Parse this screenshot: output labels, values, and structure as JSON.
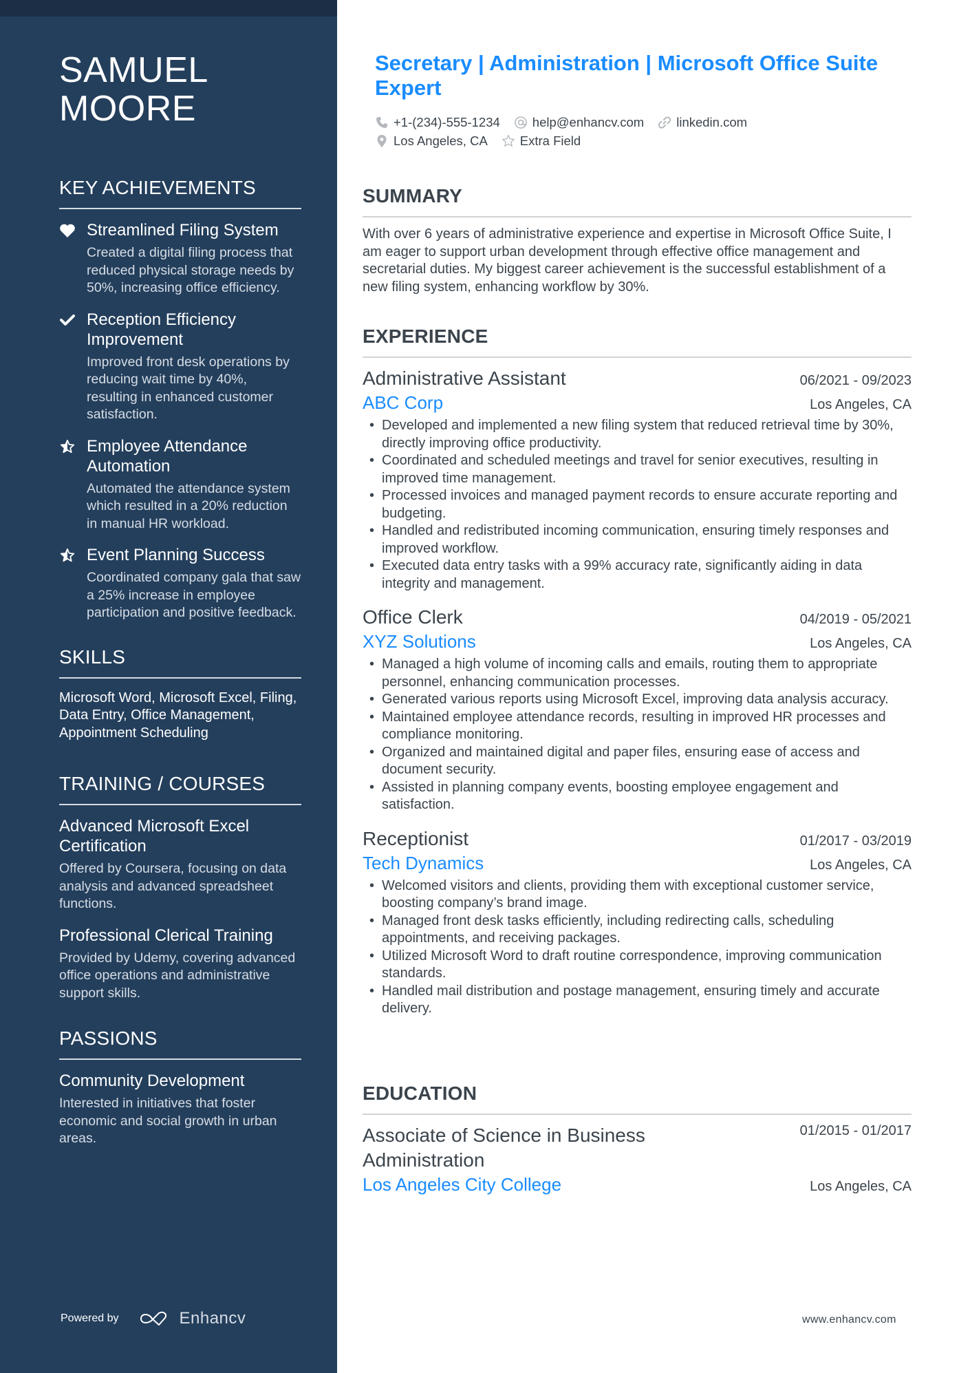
{
  "sidebar": {
    "name_line1": "SAMUEL",
    "name_line2": "MOORE",
    "achievements": {
      "heading": "KEY ACHIEVEMENTS",
      "items": [
        {
          "icon": "heart-icon",
          "title": "Streamlined Filing System",
          "desc": "Created a digital filing process that reduced physical storage needs by 50%, increasing office efficiency."
        },
        {
          "icon": "check-icon",
          "title": "Reception Efficiency Improvement",
          "desc": "Improved front desk operations by reducing wait time by 40%, resulting in enhanced customer satisfaction."
        },
        {
          "icon": "half-star-icon",
          "title": "Employee Attendance Automation",
          "desc": "Automated the attendance system which resulted in a 20% reduction in manual HR workload."
        },
        {
          "icon": "half-star-icon",
          "title": "Event Planning Success",
          "desc": "Coordinated company gala that saw a 25% increase in employee participation and positive feedback."
        }
      ]
    },
    "skills": {
      "heading": "SKILLS",
      "text": "Microsoft Word, Microsoft Excel, Filing, Data Entry, Office Management, Appointment Scheduling"
    },
    "training": {
      "heading": "TRAINING / COURSES",
      "items": [
        {
          "title": "Advanced Microsoft Excel Certification",
          "desc": "Offered by Coursera, focusing on data analysis and advanced spreadsheet functions."
        },
        {
          "title": "Professional Clerical Training",
          "desc": "Provided by Udemy, covering advanced office operations and administrative support skills."
        }
      ]
    },
    "passions": {
      "heading": "PASSIONS",
      "items": [
        {
          "title": "Community Development",
          "desc": "Interested in initiatives that foster economic and social growth in urban areas."
        }
      ]
    },
    "powered_by": {
      "label": "Powered by",
      "brand": "Enhancv"
    }
  },
  "header": {
    "headline": "Secretary | Administration | Microsoft Office Suite Expert",
    "contacts": {
      "phone": "+1-(234)-555-1234",
      "email": "help@enhancv.com",
      "link": "linkedin.com",
      "location": "Los Angeles, CA",
      "extra": "Extra Field"
    }
  },
  "summary": {
    "heading": "SUMMARY",
    "text": "With over 6 years of administrative experience and expertise in Microsoft Office Suite, I am eager to support urban development through effective office management and secretarial duties. My biggest career achievement is the successful establishment of a new filing system, enhancing workflow by 30%."
  },
  "experience": {
    "heading": "EXPERIENCE",
    "jobs": [
      {
        "title": "Administrative Assistant",
        "dates": "06/2021 - 09/2023",
        "company": "ABC Corp",
        "location": "Los Angeles, CA",
        "bullets": [
          "Developed and implemented a new filing system that reduced retrieval time by 30%, directly improving office productivity.",
          "Coordinated and scheduled meetings and travel for senior executives, resulting in improved time management.",
          "Processed invoices and managed payment records to ensure accurate reporting and budgeting.",
          "Handled and redistributed incoming communication, ensuring timely responses and improved workflow.",
          "Executed data entry tasks with a 99% accuracy rate, significantly aiding in data integrity and management."
        ]
      },
      {
        "title": "Office Clerk",
        "dates": "04/2019 - 05/2021",
        "company": "XYZ Solutions",
        "location": "Los Angeles, CA",
        "bullets": [
          "Managed a high volume of incoming calls and emails, routing them to appropriate personnel, enhancing communication processes.",
          "Generated various reports using Microsoft Excel, improving data analysis accuracy.",
          "Maintained employee attendance records, resulting in improved HR processes and compliance monitoring.",
          "Organized and maintained digital and paper files, ensuring ease of access and document security.",
          "Assisted in planning company events, boosting employee engagement and satisfaction."
        ]
      },
      {
        "title": "Receptionist",
        "dates": "01/2017 - 03/2019",
        "company": "Tech Dynamics",
        "location": "Los Angeles, CA",
        "bullets": [
          "Welcomed visitors and clients, providing them with exceptional customer service, boosting company’s brand image.",
          "Managed front desk tasks efficiently, including redirecting calls, scheduling appointments, and receiving packages.",
          "Utilized Microsoft Word to draft routine correspondence, improving communication standards.",
          "Handled mail distribution and postage management, ensuring timely and accurate delivery."
        ]
      }
    ]
  },
  "education": {
    "heading": "EDUCATION",
    "items": [
      {
        "degree": "Associate of Science in Business Administration",
        "dates": "01/2015 - 01/2017",
        "school": "Los Angeles City College",
        "location": "Los Angeles, CA"
      }
    ]
  },
  "footer": {
    "site": "www.enhancv.com"
  },
  "colors": {
    "sidebar": "#243f5c",
    "sidebar_top": "#1b2e45",
    "accent": "#1a8cff",
    "text": "#3b444c",
    "icon_gray": "#b5b9bd"
  }
}
